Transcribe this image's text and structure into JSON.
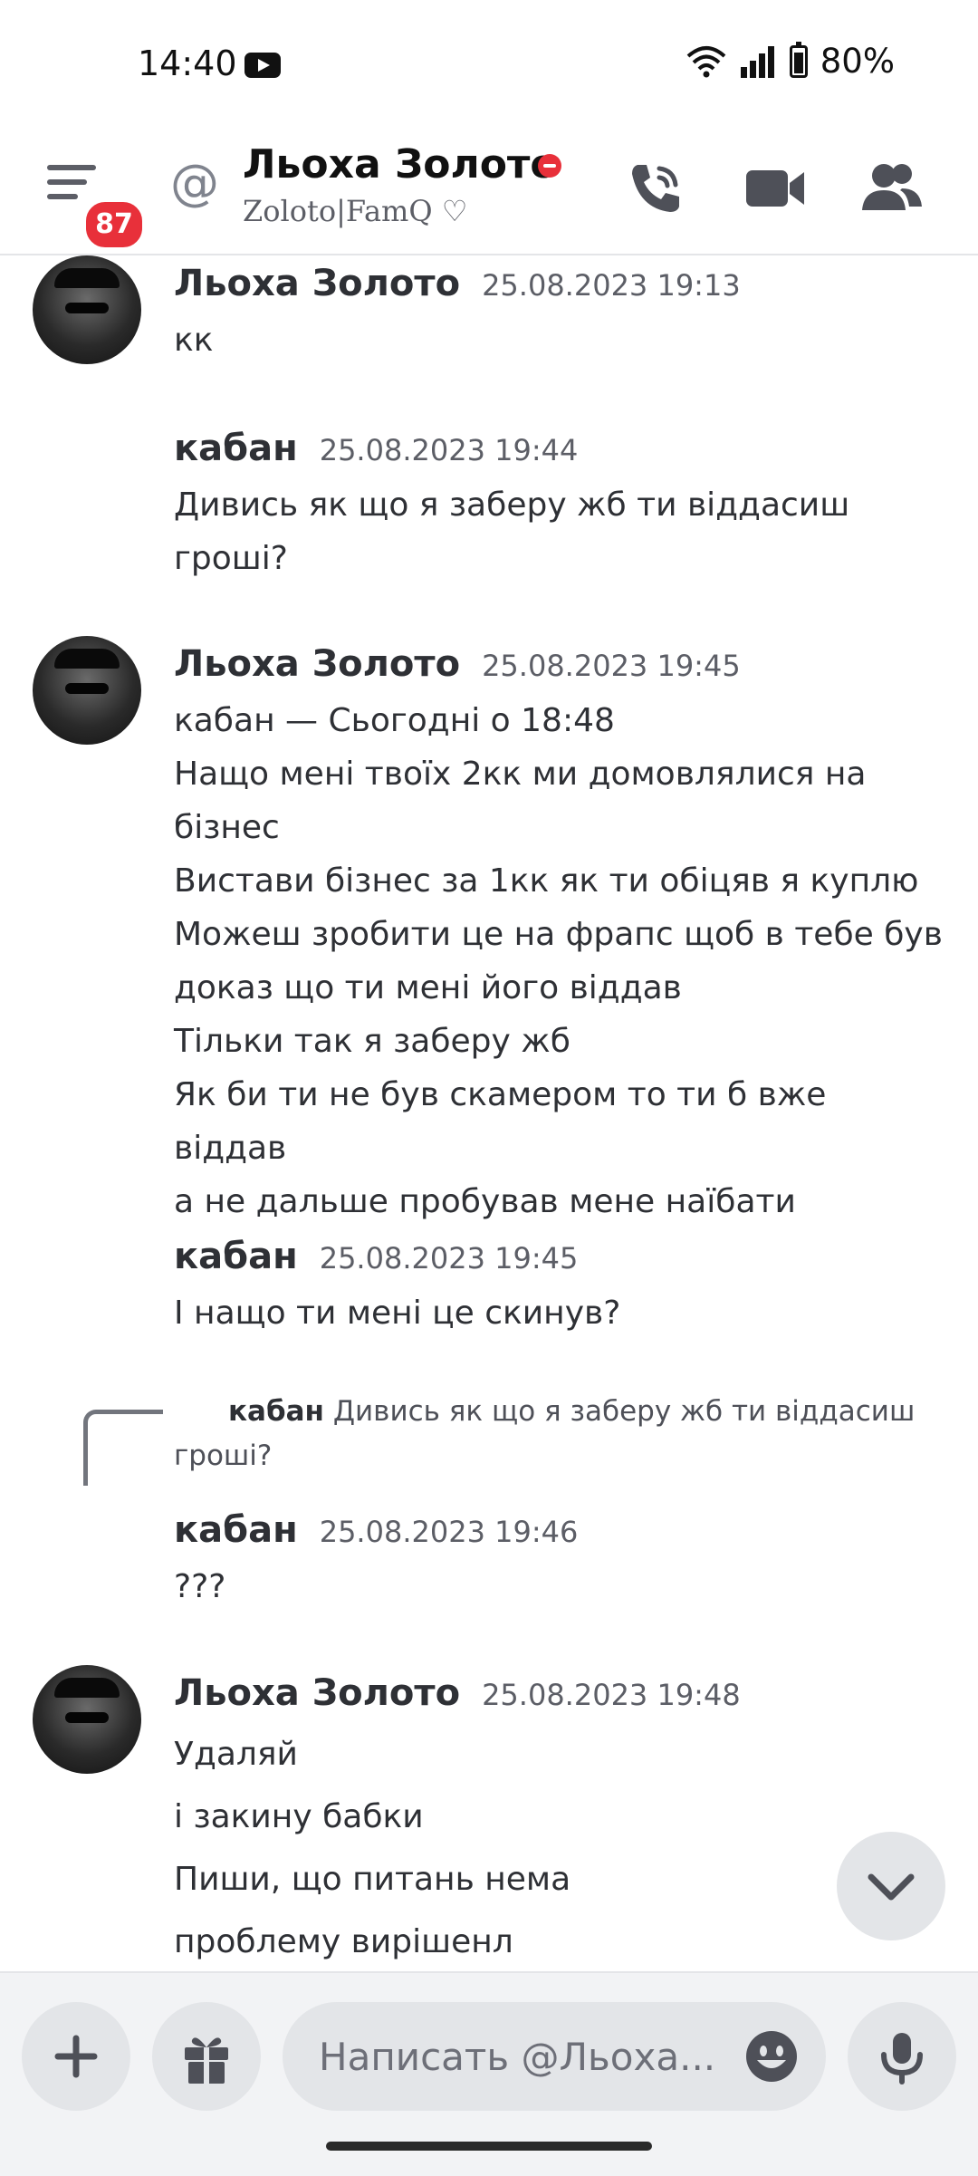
{
  "status_bar": {
    "time": "14:40",
    "battery": "80%"
  },
  "header": {
    "unread_badge": "87",
    "title": "Льоха Золото",
    "subtitle": "Zoloto|FamQ ♡"
  },
  "messages": [
    {
      "author": "Льоха Золото",
      "time": "25.08.2023 19:13",
      "lines": [
        "кк"
      ]
    },
    {
      "author": "кабан",
      "time": "25.08.2023 19:44",
      "lines": [
        "Дивись як що я заберу жб ти віддасиш",
        "гроші?"
      ]
    },
    {
      "author": "Льоха Золото",
      "time": "25.08.2023 19:45",
      "lines": [
        "кабан — Сьогодні о 18:48",
        "Нащо мені твоїх 2кк ми домовлялися на",
        "бізнес",
        "Вистави бізнес за 1кк як ти обіцяв я куплю",
        "Можеш зробити це на фрапс щоб в тебе був",
        "доказ що ти мені його віддав",
        "Тільки так я заберу жб",
        "Як би ти не був скамером то ти б вже віддав",
        "а не дальше пробував мене наїбати"
      ]
    },
    {
      "author": "кабан",
      "time": "25.08.2023 19:45",
      "lines": [
        "І нащо ти мені це скинув?"
      ]
    },
    {
      "reply_author": "кабан",
      "reply_line1": "Дивись як що я заберу жб ти віддасиш",
      "reply_line2": "гроші?",
      "author": "кабан",
      "time": "25.08.2023 19:46",
      "lines": [
        "???"
      ]
    },
    {
      "author": "Льоха Золото",
      "time": "25.08.2023 19:48",
      "lines": [
        "Удаляй",
        "і закину бабки",
        "Пиши, що питань нема",
        "проблему вирішенл"
      ]
    }
  ],
  "composer": {
    "placeholder": "Написать @Льоха..."
  },
  "icons": {
    "menu": "hamburger-menu-icon",
    "at": "at-icon",
    "status": "do-not-disturb-icon",
    "call": "phone-call-icon",
    "video": "video-camera-icon",
    "members": "members-icon",
    "add": "plus-icon",
    "gift": "gift-icon",
    "emoji": "emoji-icon",
    "mic": "microphone-icon",
    "scroll": "chevron-down-icon"
  },
  "colors": {
    "accent_red": "#e8303a",
    "background": "#ffffff",
    "text": "#2e3035",
    "muted": "#5c5e66"
  }
}
